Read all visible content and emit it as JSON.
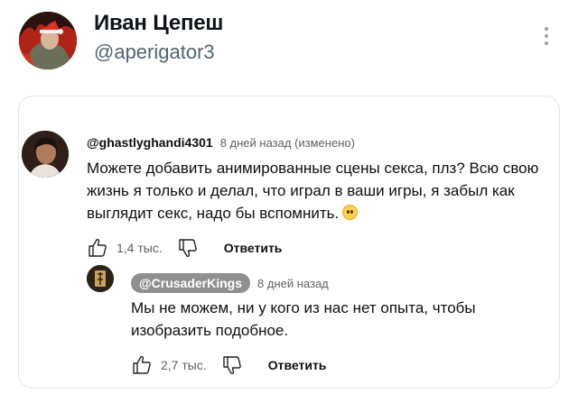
{
  "tweet": {
    "author_name": "Иван Цепеш",
    "author_handle": "@aperigator3"
  },
  "comments": [
    {
      "author": "@ghastlyghandi4301",
      "time": "8 дней назад (изменено)",
      "text": "Можете добавить анимированные сцены секса, плз? Всю свою жизнь я только и делал, что играл в ваши игры, я забыл как выглядит секс, надо бы вспомнить.",
      "emoji": "pleading-face",
      "likes": "1,4 тыс.",
      "reply_label": "Ответить"
    },
    {
      "author": "@CrusaderKings",
      "time": "8 дней назад",
      "text": "Мы не можем, ни у кого из нас нет опыта, чтобы изобразить подобное.",
      "likes": "2,7 тыс.",
      "reply_label": "Ответить"
    }
  ],
  "colors": {
    "text_primary": "#0f1419",
    "text_secondary": "#536471",
    "meta_grey": "#606060",
    "author_pill": "#909090"
  }
}
